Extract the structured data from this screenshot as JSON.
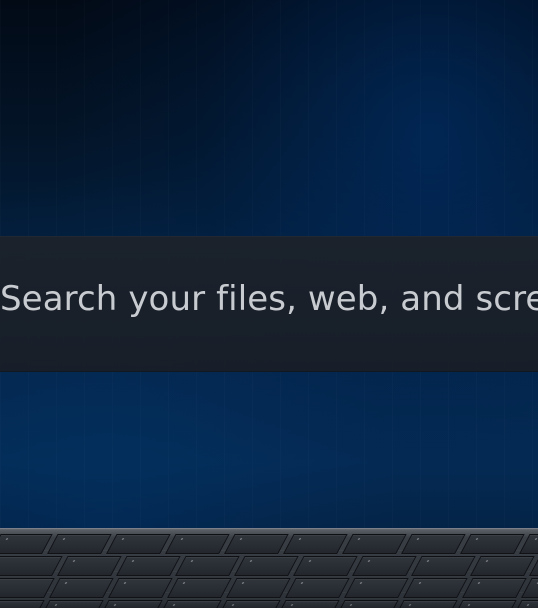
{
  "screen": {
    "search": {
      "prompt": "Search your files, web, and screen"
    }
  },
  "colors": {
    "background_top": "#020a16",
    "background_bottom": "#042b54",
    "search_panel": "#1c222b",
    "search_text": "#c8ccd1",
    "keyboard": "#2b3037"
  }
}
